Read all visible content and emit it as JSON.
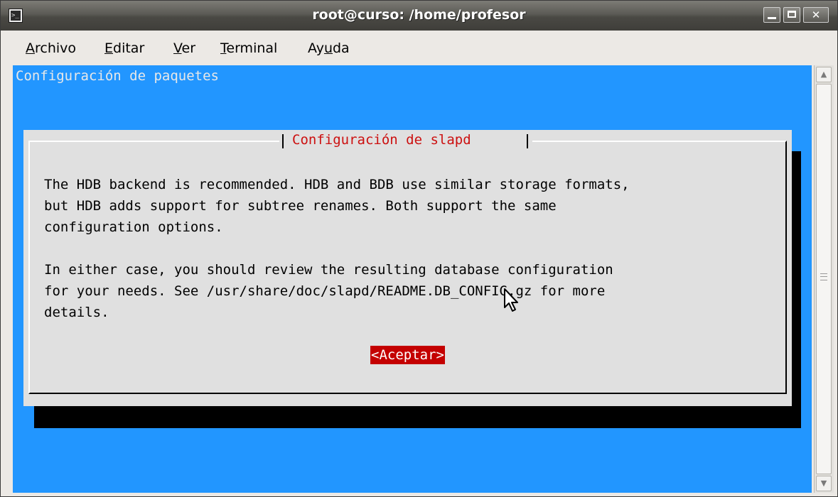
{
  "window": {
    "title": "root@curso: /home/profesor",
    "icon": "terminal-icon",
    "controls": [
      "minimize-icon",
      "maximize-icon",
      "close-icon"
    ]
  },
  "menubar": {
    "items": [
      {
        "pre": "",
        "mn": "A",
        "post": "rchivo"
      },
      {
        "pre": "",
        "mn": "E",
        "post": "ditar"
      },
      {
        "pre": "",
        "mn": "V",
        "post": "er"
      },
      {
        "pre": "",
        "mn": "T",
        "post": "erminal"
      },
      {
        "pre": "Ay",
        "mn": "u",
        "post": "da"
      }
    ]
  },
  "terminal": {
    "header": "Configuración de paquetes",
    "dialog": {
      "title": "Configuración de slapd",
      "body": "The HDB backend is recommended. HDB and BDB use similar storage formats,\nbut HDB adds support for subtree renames. Both support the same\nconfiguration options.\n\nIn either case, you should review the resulting database configuration\nfor your needs. See /usr/share/doc/slapd/README.DB_CONFIG.gz for more\ndetails.",
      "button": "<Aceptar>"
    }
  },
  "colors": {
    "terminal_bg": "#2296ff",
    "dialog_bg": "#e0e0e0",
    "dialog_title": "#cc1010",
    "button_bg": "#c40000"
  }
}
